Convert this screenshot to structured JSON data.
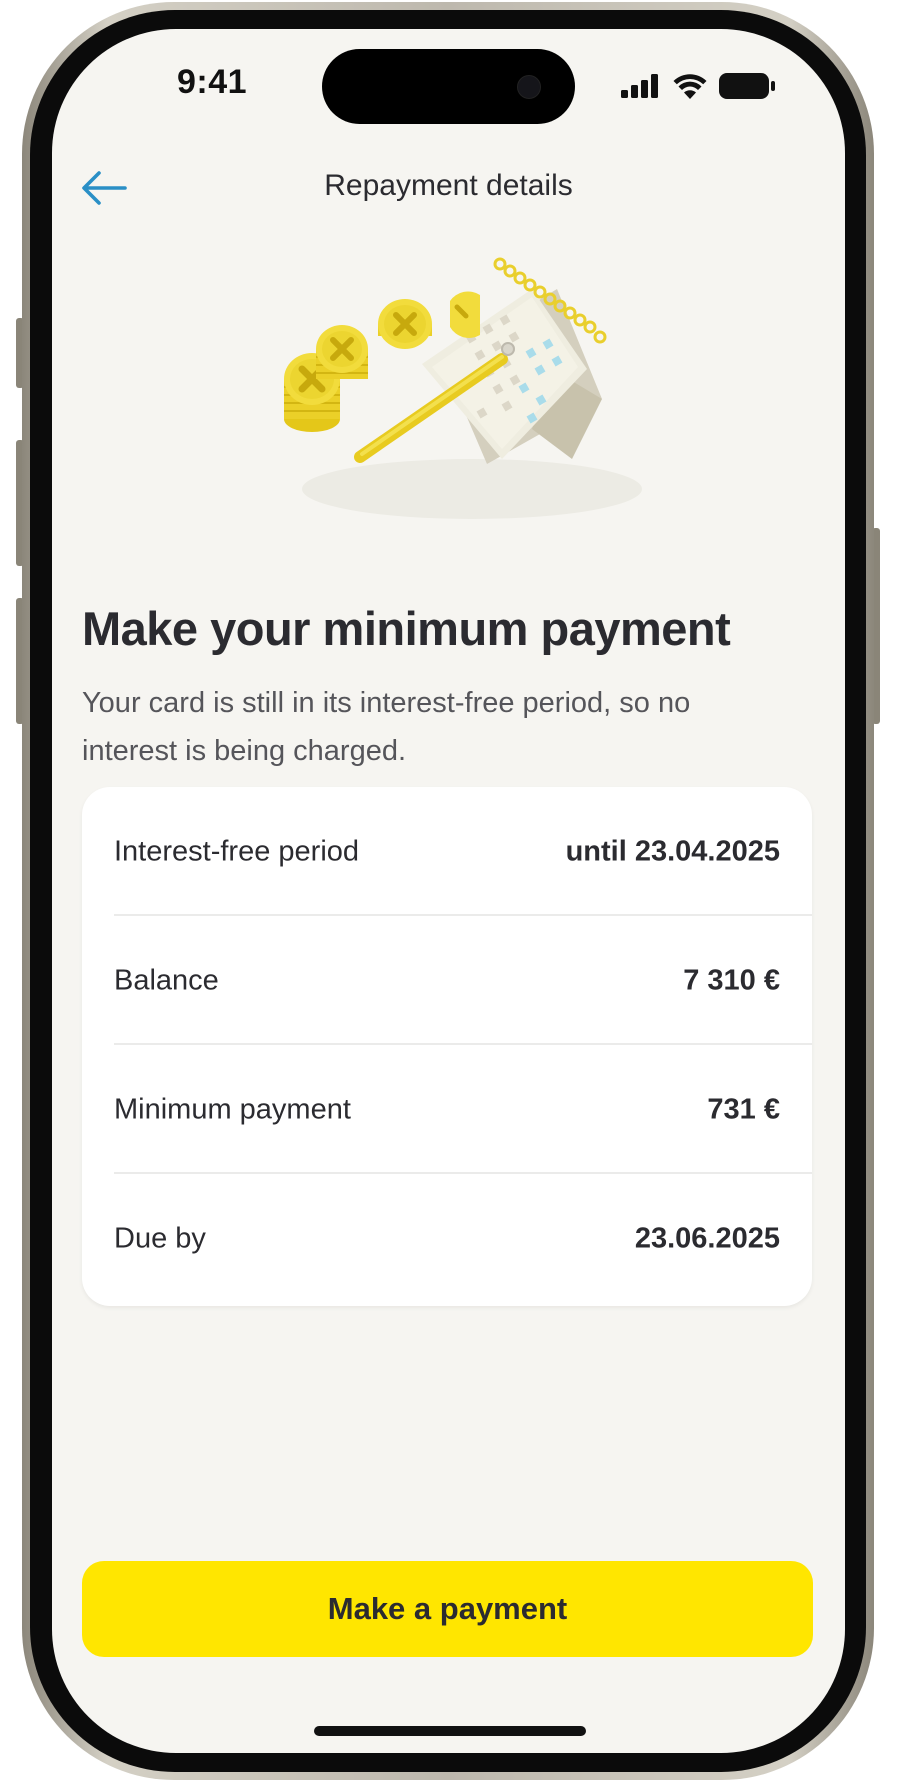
{
  "status_bar": {
    "time": "9:41"
  },
  "nav": {
    "title": "Repayment details",
    "back_icon": "arrow-left-icon"
  },
  "illustration": {
    "name": "coins-and-calendar-illustration"
  },
  "content": {
    "headline": "Make your minimum payment",
    "description": "Your card is still in its interest-free period, so no interest is being charged."
  },
  "details": [
    {
      "label": "Interest-free period",
      "value": "until 23.04.2025"
    },
    {
      "label": "Balance",
      "value": "7 310 €"
    },
    {
      "label": "Minimum payment",
      "value": "731 €"
    },
    {
      "label": "Due by",
      "value": "23.06.2025"
    }
  ],
  "actions": {
    "primary": "Make a payment"
  },
  "colors": {
    "accent": "#FFE600",
    "back_arrow": "#2A8FC6",
    "screen_bg": "#F6F5F1",
    "text": "#2B2B30"
  }
}
